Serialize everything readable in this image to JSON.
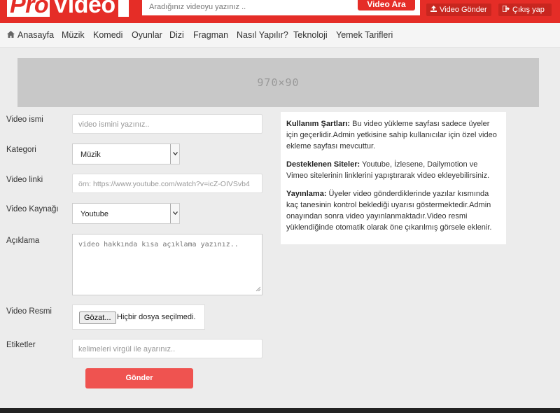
{
  "header": {
    "logo_part1": "Pro",
    "logo_part2": "Video",
    "search_placeholder": "Aradığınız videoyu yazınız ..",
    "search_button": "Video Ara",
    "send_video": "Video Gönder",
    "logout": "Çıkış yap",
    "brand_color": "#e52d27"
  },
  "nav": {
    "items": [
      "Anasayfa",
      "Müzik",
      "Komedi",
      "Oyunlar",
      "Dizi",
      "Fragman",
      "Nasıl Yapılır?",
      "Teknoloji",
      "Yemek Tarifleri"
    ]
  },
  "banner": {
    "text": "970×90"
  },
  "form": {
    "name_label": "Video ismi",
    "name_placeholder": "video ismini yazınız..",
    "category_label": "Kategori",
    "category_value": "Müzik",
    "link_label": "Video linki",
    "link_placeholder": "örn: https://www.youtube.com/watch?v=icZ-OIVSvb4",
    "source_label": "Video Kaynağı",
    "source_value": "Youtube",
    "desc_label": "Açıklama",
    "desc_placeholder": "video hakkında kısa açıklama yazınız..",
    "image_label": "Video Resmi",
    "file_button": "Gözat...",
    "file_status": "Hiçbir dosya seçilmedi.",
    "tags_label": "Etiketler",
    "tags_placeholder": "kelimeleri virgül ile ayarınız..",
    "submit": "Gönder",
    "submit_color": "#ef5350"
  },
  "info": {
    "terms_title": "Kullanım Şartları:",
    "terms_text": " Bu video yükleme sayfası sadece üyeler için geçerlidir.Admin yetkisine sahip kullanıcılar için özel video ekleme sayfası mevcuttur.",
    "sites_title": "Desteklenen Siteler:",
    "sites_text": " Youtube, İzlesene, Dailymotion ve Vimeo sitelerinin linklerini yapıştırarak video ekleyebilirsiniz.",
    "publish_title": "Yayınlama:",
    "publish_text": " Üyeler video gönderdiklerinde yazılar kısmında kaç tanesinin kontrol beklediği uyarısı göstermektedir.Admin onayından sonra video yayınlanmaktadır.Video resmi yüklendiğinde otomatik olarak öne çıkarılmış görsele eklenir."
  }
}
